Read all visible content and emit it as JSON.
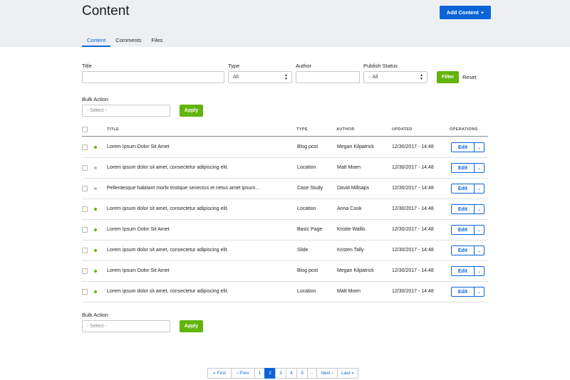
{
  "header": {
    "title": "Content",
    "add_button": "Add Content",
    "add_icon": "plus-icon",
    "tabs": [
      {
        "label": "Content",
        "active": true
      },
      {
        "label": "Comments",
        "active": false
      },
      {
        "label": "Files",
        "active": false
      }
    ]
  },
  "filters": {
    "title_label": "Title",
    "title_value": "",
    "type_label": "Type",
    "type_value": "All",
    "author_label": "Author",
    "author_value": "",
    "status_label": "Publish Status",
    "status_value": "All",
    "filter_button": "Filter",
    "reset_link": "Reset"
  },
  "bulk_top": {
    "label": "Bulk Action",
    "placeholder": "- Select -",
    "apply": "Apply"
  },
  "bulk_bottom": {
    "label": "Bulk Action",
    "placeholder": "- Select -",
    "apply": "Apply"
  },
  "table": {
    "columns": [
      "TITLE",
      "TYPE",
      "AUTHOR",
      "UPDATED",
      "OPERATIONS"
    ],
    "rows": [
      {
        "title": "Lorem Ipsum Dolor Sit Amet",
        "type": "Blog post",
        "author": "Megan Kilpatrick",
        "updated": "12/30/2017 - 14:48",
        "status": "published",
        "op": "Edit"
      },
      {
        "title": "Lorem ipsum dolor sit amet, consectetur adipiscing elit.",
        "type": "Location",
        "author": "Matt Moen",
        "updated": "12/30/2017 - 14:48",
        "status": "unpublished",
        "op": "Edit"
      },
      {
        "title": "Pellentesque habitant morbi tristique senectus et netus amet ipsum...",
        "type": "Case Study",
        "author": "David Millsaps",
        "updated": "12/30/2017 - 14:48",
        "status": "unpublished",
        "op": "Edit"
      },
      {
        "title": "Lorem ipsum dolor sit amet, consectetur adipiscing elit.",
        "type": "Location",
        "author": "Anna Cook",
        "updated": "12/30/2017 - 14:48",
        "status": "published",
        "op": "Edit"
      },
      {
        "title": "Lorem Ipsum Dolor Sit Amet",
        "type": "Basic Page",
        "author": "Kristie Wallis",
        "updated": "12/30/2017 - 14:48",
        "status": "published",
        "op": "Edit"
      },
      {
        "title": "Lorem ipsum dolor sit amet, consectetur adipiscing elit.",
        "type": "Slide",
        "author": "Kristen Tally",
        "updated": "12/30/2017 - 14:48",
        "status": "published",
        "op": "Edit"
      },
      {
        "title": "Lorem Ipsum Dolor Sit Amet",
        "type": "Blog post",
        "author": "Megan Kilpatrick",
        "updated": "12/30/2017 - 14:48",
        "status": "published",
        "op": "Edit"
      },
      {
        "title": "Lorem ipsum dolor sit amet, consectetur adipiscing elit.",
        "type": "Location",
        "author": "Matt Moen",
        "updated": "12/30/2017 - 14:48",
        "status": "published",
        "op": "Edit"
      }
    ]
  },
  "pagination": {
    "first": "« First",
    "prev": "‹ Prev",
    "pages": [
      "1",
      "2",
      "3",
      "4",
      "5"
    ],
    "current": "2",
    "ellipsis": "...",
    "next": "Next ›",
    "last": "Last »"
  },
  "colors": {
    "accent": "#0b64d8",
    "green": "#61b40a",
    "published": "#61b40a",
    "unpublished": "#b8bcc2",
    "header_bg": "#edf0f3"
  }
}
